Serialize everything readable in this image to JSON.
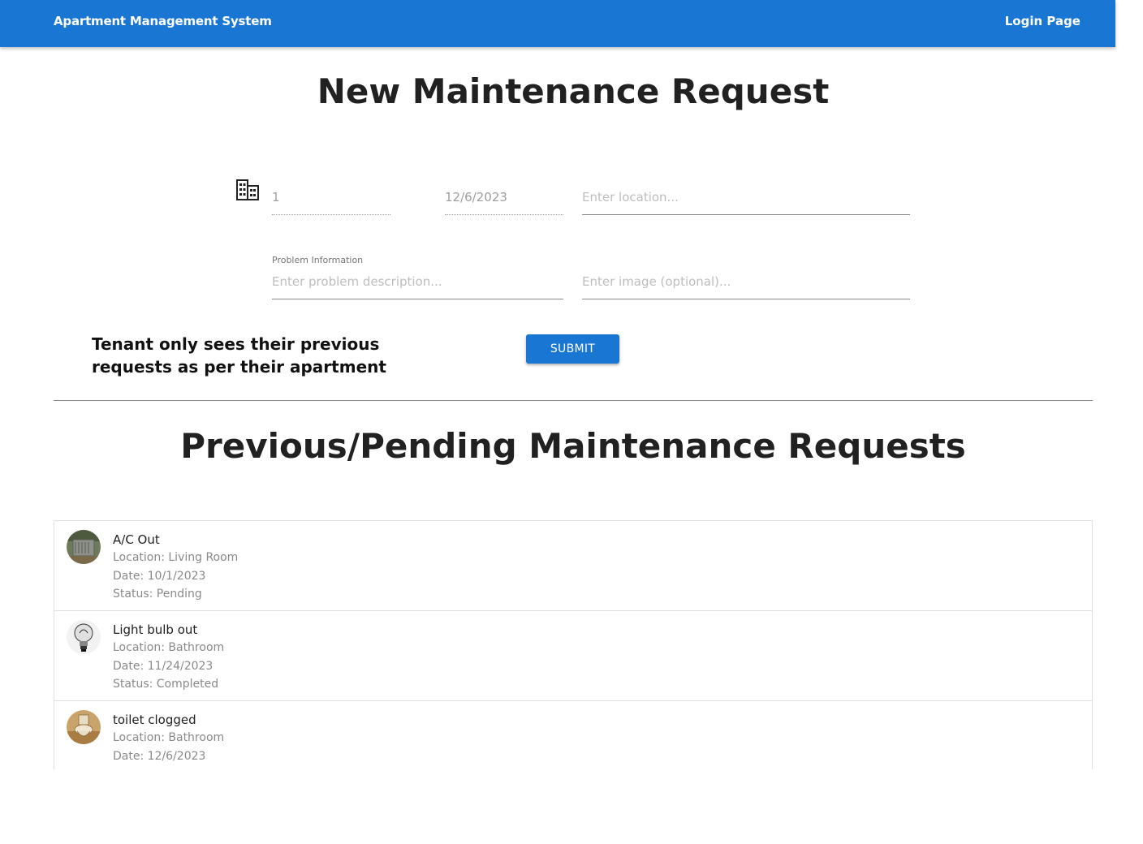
{
  "header": {
    "brand": "Apartment Management System",
    "login_link": "Login Page"
  },
  "form": {
    "title": "New Maintenance Request",
    "apartment_value": "1",
    "date_value": "12/6/2023",
    "location_placeholder": "Enter location...",
    "problem_label": "Problem Information",
    "problem_placeholder": "Enter problem description...",
    "image_placeholder": "Enter image (optional)...",
    "submit_label": "SUBMIT",
    "note": "Tenant only sees their previous requests as per their apartment"
  },
  "requests": {
    "title": "Previous/Pending Maintenance Requests",
    "items": [
      {
        "title": "A/C Out",
        "location": "Location: Living Room",
        "date": "Date: 10/1/2023",
        "status": "Status: Pending",
        "thumbnail": "ac-unit-photo"
      },
      {
        "title": "Light bulb out",
        "location": "Location: Bathroom",
        "date": "Date: 11/24/2023",
        "status": "Status: Completed",
        "thumbnail": "light-bulb-photo"
      },
      {
        "title": "toilet clogged",
        "location": "Location: Bathroom",
        "date": "Date: 12/6/2023",
        "status": "",
        "thumbnail": "toilet-photo"
      }
    ]
  },
  "colors": {
    "primary": "#1976d2",
    "text": "#212121",
    "secondary_text": "#8a8a8a"
  }
}
